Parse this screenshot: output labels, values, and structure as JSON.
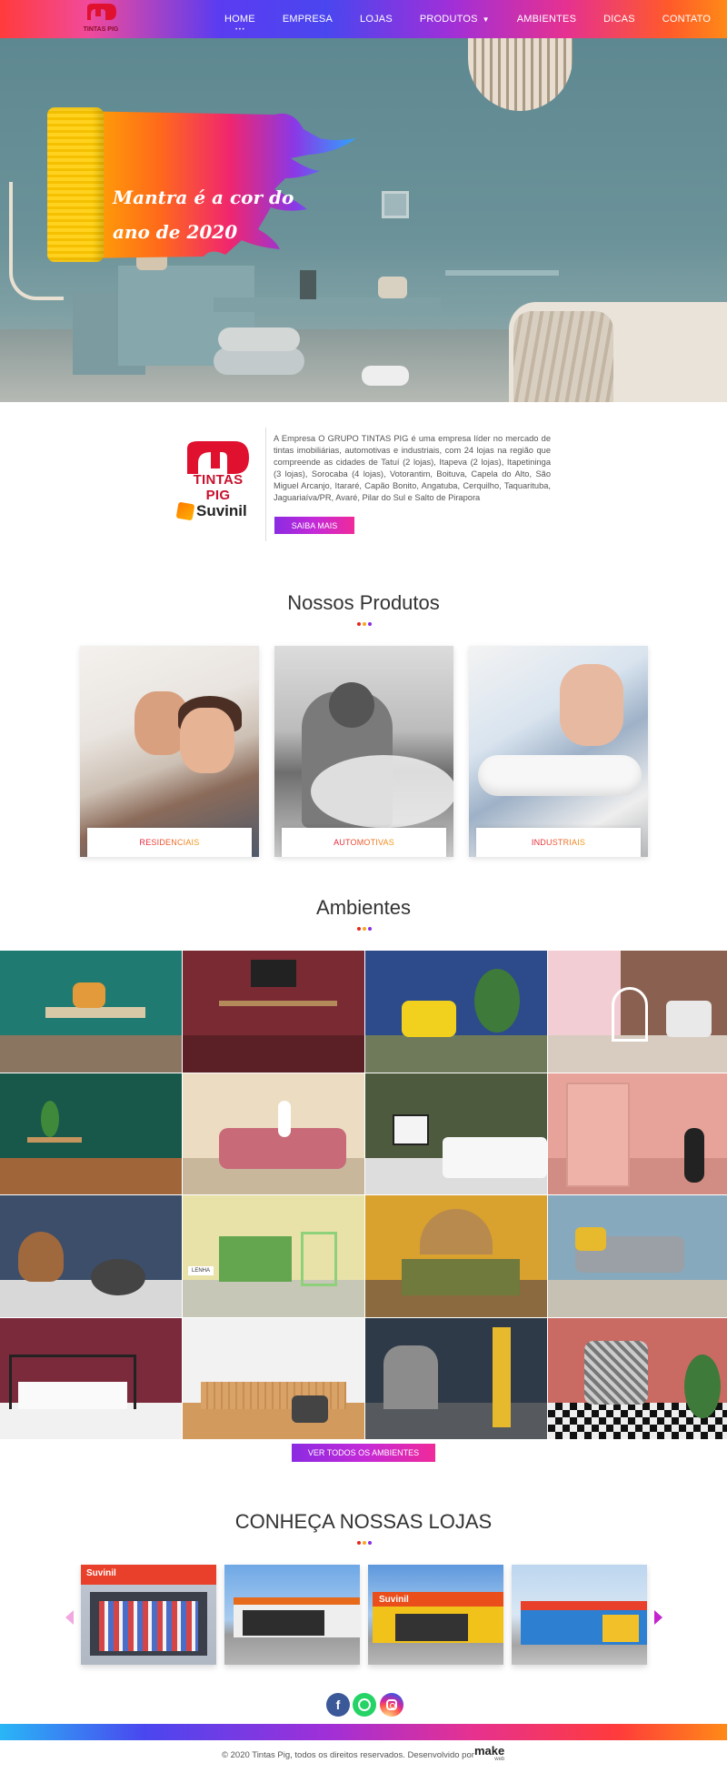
{
  "nav": {
    "logo_text": "TINTAS PIG",
    "items": [
      {
        "label": "HOME"
      },
      {
        "label": "EMPRESA"
      },
      {
        "label": "LOJAS"
      },
      {
        "label": "PRODUTOS"
      },
      {
        "label": "AMBIENTES"
      },
      {
        "label": "DICAS"
      },
      {
        "label": "CONTATO"
      }
    ]
  },
  "hero": {
    "title": "Mantra é a cor do ano de 2020"
  },
  "about": {
    "logo_text": "TINTAS PIG",
    "partner": "Suvinil",
    "text": "A Empresa O GRUPO TINTAS PIG é uma empresa líder no mercado de tintas imobiliárias, automotivas e industriais, com 24 lojas na região que compreende as cidades de Tatuí (2 lojas), Itapeva (2 lojas), Itapetininga (3 lojas), Sorocaba (4 lojas), Votorantim, Boituva, Capela do Alto, São Miguel Arcanjo, Itararé, Capão Bonito, Angatuba, Cerquilho, Taquarituba, Jaguariaíva/PR, Avaré, Pilar do Sul e Salto de Pirapora",
    "button": "SAIBA MAIS"
  },
  "products": {
    "title": "Nossos Produtos",
    "items": [
      {
        "label": "RESIDENCIAIS"
      },
      {
        "label": "AUTOMOTIVAS"
      },
      {
        "label": "INDUSTRIAIS"
      }
    ]
  },
  "ambientes": {
    "title": "Ambientes",
    "tile_caption": "LENHA",
    "button": "VER TODOS OS AMBIENTES"
  },
  "stores": {
    "title": "CONHEÇA NOSSAS LOJAS",
    "sign_text": "Suvinil"
  },
  "footer": {
    "copyright": "© 2020 Tintas Pig, todos os direitos reservados. Desenvolvido por",
    "dev_brand": "make",
    "dev_brand_sub": "web"
  },
  "colors": {
    "dot1": "#e8251f",
    "dot2": "#f6a623",
    "dot3": "#8b2be2",
    "brand_red": "#c8102e"
  },
  "icons": [
    "facebook-icon",
    "whatsapp-icon",
    "instagram-icon",
    "chevron-left-icon",
    "chevron-right-icon",
    "paint-roller-icon"
  ]
}
